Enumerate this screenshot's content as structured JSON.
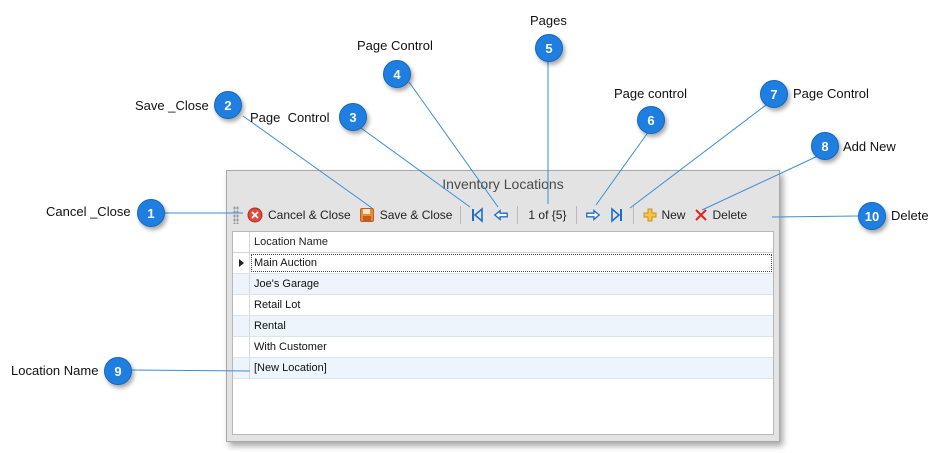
{
  "window": {
    "title": "Inventory Locations"
  },
  "toolbar": {
    "cancel_close": "Cancel & Close",
    "save_close": "Save & Close",
    "page_indicator": "1 of {5}",
    "new": "New",
    "delete": "Delete"
  },
  "grid": {
    "column_header": "Location Name",
    "rows": [
      "Main Auction",
      "Joe's Garage",
      "Retail Lot",
      "Rental",
      "With Customer",
      "[New Location]"
    ]
  },
  "callouts": [
    {
      "number": "1",
      "label": "Cancel _Close"
    },
    {
      "number": "2",
      "label": "Save _Close"
    },
    {
      "number": "3",
      "label": "Page  Control"
    },
    {
      "number": "4",
      "label": "Page Control"
    },
    {
      "number": "5",
      "label": "Pages"
    },
    {
      "number": "6",
      "label": "Page control"
    },
    {
      "number": "7",
      "label": "Page Control"
    },
    {
      "number": "8",
      "label": "Add New"
    },
    {
      "number": "9",
      "label": "Location Name"
    },
    {
      "number": "10",
      "label": "Delete"
    }
  ],
  "colors": {
    "badge": "#1e7fe0",
    "leader_line": "#3a8fd8",
    "alt_row": "#edf4fb"
  },
  "icons": [
    "grip-icon",
    "cancel-icon",
    "save-icon",
    "first-page-icon",
    "prev-page-icon",
    "next-page-icon",
    "last-page-icon",
    "add-icon",
    "delete-icon",
    "row-indicator-icon"
  ]
}
